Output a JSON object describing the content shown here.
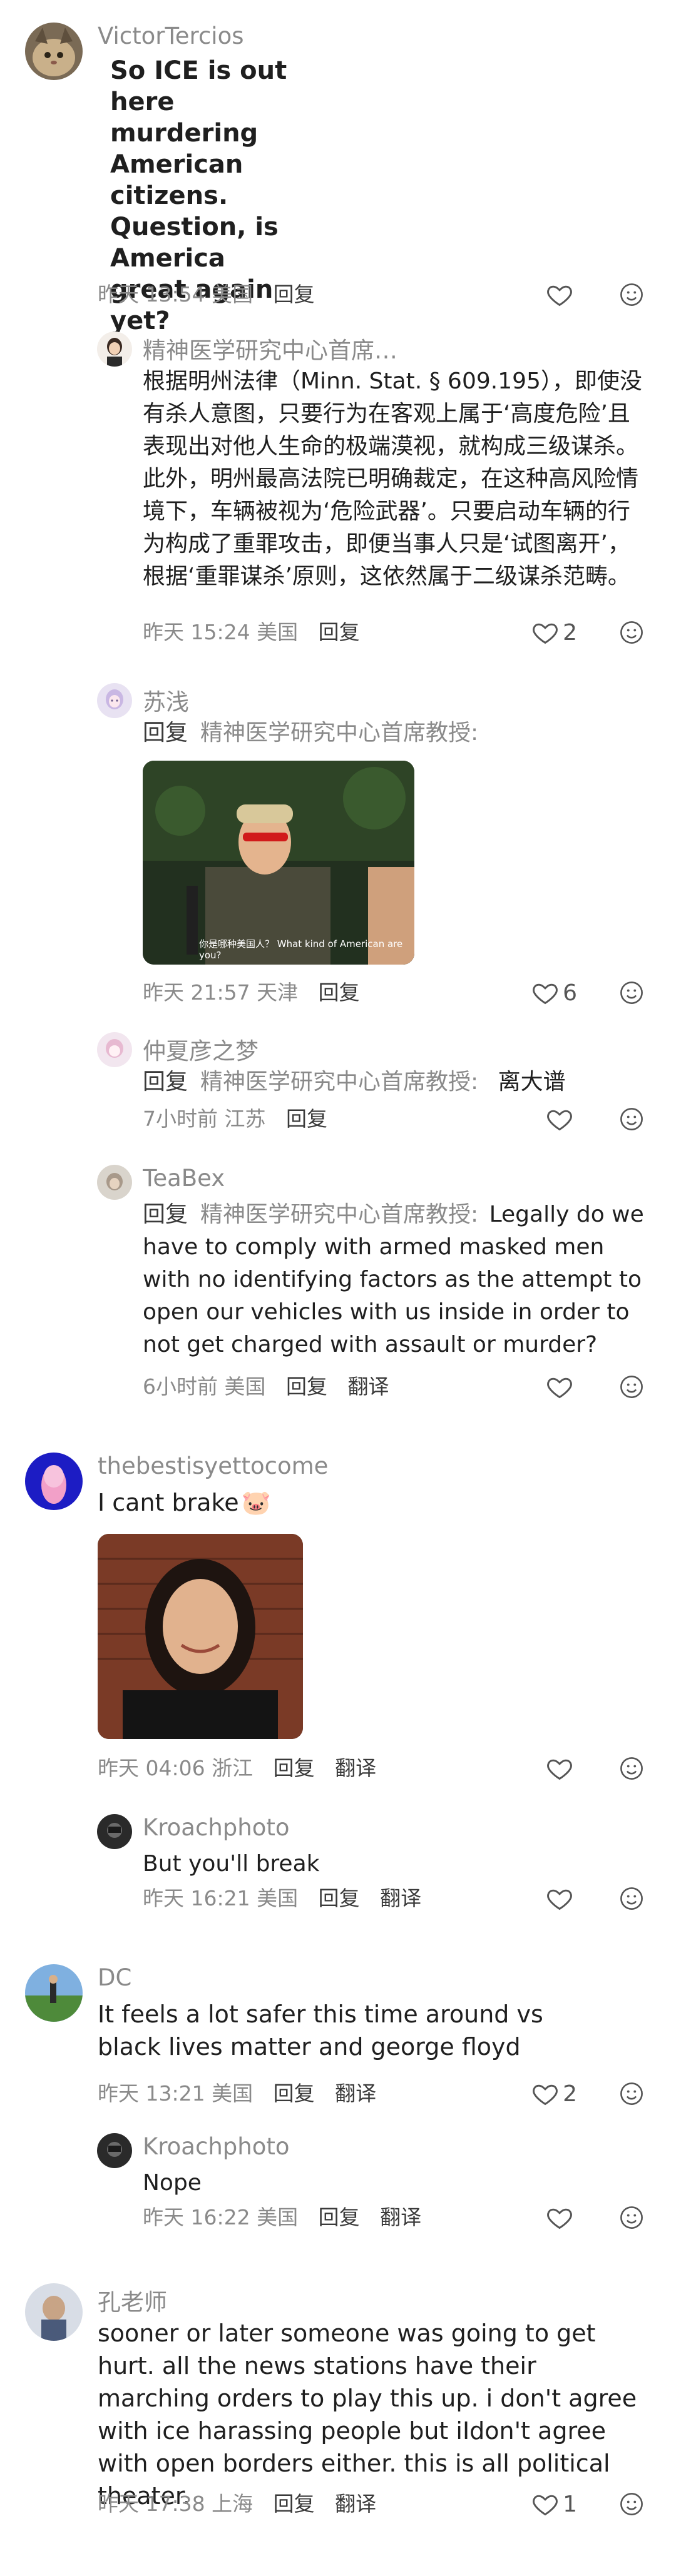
{
  "labels": {
    "reply": "回复",
    "translate": "翻译"
  },
  "comments": [
    {
      "user": "VictorTercios",
      "text": "So ICE is out here murdering American citizens. Question, is America great again yet?",
      "time": "昨天 13:54",
      "location": "美国",
      "likes": "",
      "replies": [
        {
          "user": "精神医学研究中心首席…",
          "text": "根据明州法律（Minn. Stat. § 609.195），即使没有杀人意图，只要行为在客观上属于‘高度危险’且表现出对他人生命的极端漠视，就构成三级谋杀。此外，明州最高法院已明确裁定，在这种高风险情境下，车辆被视为‘危险武器’。只要启动车辆的行为构成了重罪攻击，即便当事人只是‘试图离开’，根据‘重罪谋杀’原则，这依然属于二级谋杀范畴。",
          "time": "昨天 15:24",
          "location": "美国",
          "likes": "2"
        },
        {
          "user": "苏浅",
          "reply_to": "精神医学研究中心首席教授:",
          "text": "",
          "image_caption": "你是哪种美国人？ What kind of American are you?",
          "time": "昨天 21:57",
          "location": "天津",
          "likes": "6"
        },
        {
          "user": "仲夏彦之梦",
          "reply_to": "精神医学研究中心首席教授:",
          "text": "离大谱",
          "time": "7小时前",
          "location": "江苏",
          "likes": ""
        },
        {
          "user": "TeaBex",
          "reply_to": "精神医学研究中心首席教授:",
          "text": "Legally do we have to comply with armed masked men with no identifying factors as the attempt to open our vehicles with us inside in order to not get charged with assault or murder?",
          "time": "6小时前",
          "location": "美国",
          "likes": "",
          "translate": true
        }
      ]
    },
    {
      "user": "thebestisyettocome",
      "text": "I cant brake",
      "emoji": "🐷",
      "time": "昨天 04:06",
      "location": "浙江",
      "likes": "",
      "translate": true,
      "replies": [
        {
          "user": "Kroachphoto",
          "text": "But you'll break",
          "time": "昨天 16:21",
          "location": "美国",
          "likes": "",
          "translate": true
        }
      ]
    },
    {
      "user": "DC",
      "text": "It feels a lot safer this time around vs black lives matter and george floyd",
      "time": "昨天 13:21",
      "location": "美国",
      "likes": "2",
      "translate": true,
      "replies": [
        {
          "user": "Kroachphoto",
          "text": "Nope",
          "time": "昨天 16:22",
          "location": "美国",
          "likes": "",
          "translate": true
        }
      ]
    },
    {
      "user": "孔老师",
      "text": "sooner or later someone was going to get hurt. all the news stations have their marching orders to play this up. i don't agree with ice harassing people but iIdon't agree with open borders either. this is all political theater.",
      "time": "昨天 17:38",
      "location": "上海",
      "likes": "1",
      "translate": true,
      "replies": []
    }
  ],
  "colors": {
    "text": "#1f1f1f",
    "muted": "#8a8a8a",
    "action": "#3a3a3a",
    "background": "#ffffff"
  },
  "icons": {
    "like": "heart-outline-icon",
    "emoji": "smiley-icon"
  }
}
